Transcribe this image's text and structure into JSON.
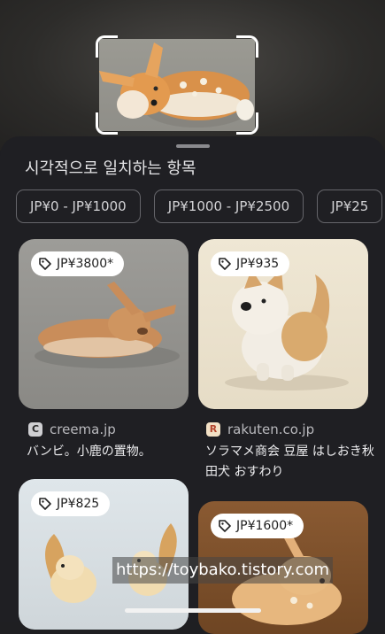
{
  "sheet": {
    "title": "시각적으로 일치하는 항목"
  },
  "filters": [
    {
      "label": "JP¥0 - JP¥1000"
    },
    {
      "label": "JP¥1000 - JP¥2500"
    },
    {
      "label": "JP¥25"
    }
  ],
  "results": [
    {
      "price": "JP¥3800*",
      "source": "creema.jp",
      "favicon": "C",
      "description": "バンビ。小鹿の置物。"
    },
    {
      "price": "JP¥935",
      "source": "rakuten.co.jp",
      "favicon": "R",
      "description": "ソラマメ商会 豆屋 はしおき秋田犬 おすわり"
    },
    {
      "price": "JP¥825"
    },
    {
      "price": "JP¥1600*"
    }
  ],
  "watermark": "https://toybako.tistory.com"
}
